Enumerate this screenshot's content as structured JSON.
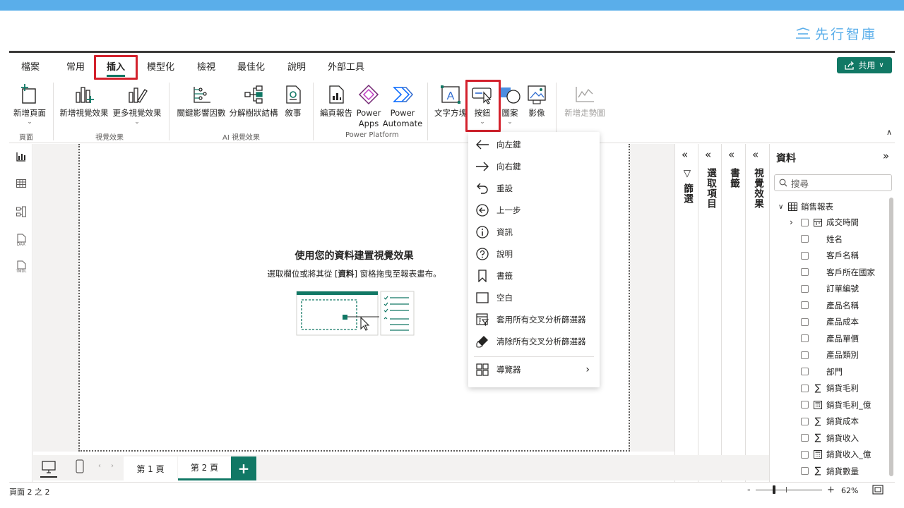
{
  "brand": {
    "name": "先行智庫"
  },
  "menu": {
    "tabs": [
      {
        "label": "檔案"
      },
      {
        "label": "常用"
      },
      {
        "label": "插入"
      },
      {
        "label": "模型化"
      },
      {
        "label": "檢視"
      },
      {
        "label": "最佳化"
      },
      {
        "label": "說明"
      },
      {
        "label": "外部工具"
      }
    ],
    "active_tab": "插入",
    "share_label": "共用"
  },
  "ribbon": {
    "new_page": "新增頁面",
    "group_page": "頁面",
    "new_visual": "新增視覺效果",
    "more_visuals": "更多視覺效果",
    "group_visuals": "視覺效果",
    "key_influencers": "關鍵影響因數",
    "decomp_tree": "分解樹狀結構",
    "narrative": "敘事",
    "group_ai": "AI 視覺效果",
    "paginated": "編頁報告",
    "power_apps_1": "Power",
    "power_apps_2": "Apps",
    "power_automate_1": "Power",
    "power_automate_2": "Automate",
    "group_platform": "Power Platform",
    "textbox": "文字方塊",
    "buttons": "按鈕",
    "shapes": "圖案",
    "image": "影像",
    "sparkline": "新增走勢圖"
  },
  "button_menu": {
    "items": [
      {
        "label": "向左鍵",
        "icon": "arrow-left-icon"
      },
      {
        "label": "向右鍵",
        "icon": "arrow-right-icon"
      },
      {
        "label": "重設",
        "icon": "reset-icon"
      },
      {
        "label": "上一步",
        "icon": "back-icon"
      },
      {
        "label": "資訊",
        "icon": "info-icon"
      },
      {
        "label": "說明",
        "icon": "help-icon"
      },
      {
        "label": "書籤",
        "icon": "bookmark-icon"
      },
      {
        "label": "空白",
        "icon": "blank-icon"
      },
      {
        "label": "套用所有交叉分析篩選器",
        "icon": "apply-slicers-icon"
      },
      {
        "label": "清除所有交叉分析篩選器",
        "icon": "clear-slicers-icon"
      }
    ],
    "navigator": "導覽器"
  },
  "canvas": {
    "empty_title": "使用您的資料建置視覺效果",
    "empty_sub_pre": "選取欄位或將其從 [",
    "empty_sub_bold": "資料",
    "empty_sub_post": "] 窗格拖曳至報表畫布。"
  },
  "panes": {
    "filters": "篩選",
    "selection": "選取項目",
    "bookmarks": "書籤",
    "visualizations": "視覺效果"
  },
  "data_pane": {
    "title": "資料",
    "search_placeholder": "搜尋",
    "table_name": "銷售報表",
    "fields": [
      {
        "label": "成交時間",
        "type": "date",
        "expandable": true
      },
      {
        "label": "姓名",
        "type": "text"
      },
      {
        "label": "客戶名稱",
        "type": "text"
      },
      {
        "label": "客戶所在國家",
        "type": "text"
      },
      {
        "label": "訂單編號",
        "type": "text"
      },
      {
        "label": "產品名稱",
        "type": "text"
      },
      {
        "label": "產品成本",
        "type": "text"
      },
      {
        "label": "產品單價",
        "type": "text"
      },
      {
        "label": "產品類別",
        "type": "text"
      },
      {
        "label": "部門",
        "type": "text"
      },
      {
        "label": "銷貨毛利",
        "type": "sum"
      },
      {
        "label": "銷貨毛利_億",
        "type": "calc"
      },
      {
        "label": "銷貨成本",
        "type": "sum"
      },
      {
        "label": "銷貨收入",
        "type": "sum"
      },
      {
        "label": "銷貨收入_億",
        "type": "calc"
      },
      {
        "label": "銷貨數量",
        "type": "sum"
      }
    ]
  },
  "pages": {
    "page1": "第 1 頁",
    "page2": "第 2 頁",
    "add": "+"
  },
  "status": {
    "page_info": "頁面 2 之 2",
    "zoom": "62%",
    "minus": "-",
    "plus": "+"
  }
}
